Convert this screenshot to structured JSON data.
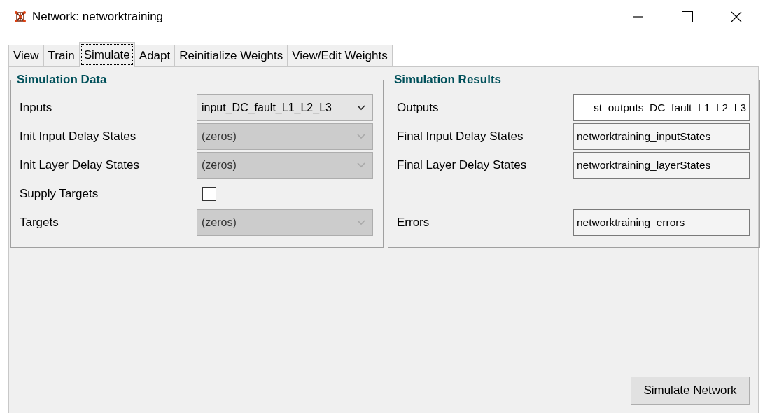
{
  "window": {
    "title": "Network: networktraining"
  },
  "tabs": [
    {
      "label": "View",
      "selected": false
    },
    {
      "label": "Train",
      "selected": false
    },
    {
      "label": "Simulate",
      "selected": true
    },
    {
      "label": "Adapt",
      "selected": false
    },
    {
      "label": "Reinitialize Weights",
      "selected": false
    },
    {
      "label": "View/Edit Weights",
      "selected": false
    }
  ],
  "simulation_data": {
    "title": "Simulation Data",
    "rows": [
      {
        "label": "Inputs",
        "kind": "dropdown",
        "value": "input_DC_fault_L1_L2_L3",
        "disabled": false
      },
      {
        "label": "Init Input Delay States",
        "kind": "dropdown",
        "value": "(zeros)",
        "disabled": true
      },
      {
        "label": "Init Layer Delay States",
        "kind": "dropdown",
        "value": "(zeros)",
        "disabled": true
      },
      {
        "label": "Supply Targets",
        "kind": "checkbox",
        "checked": false
      },
      {
        "label": "Targets",
        "kind": "dropdown",
        "value": "(zeros)",
        "disabled": true
      }
    ]
  },
  "simulation_results": {
    "title": "Simulation Results",
    "rows": [
      {
        "label": "Outputs",
        "kind": "field",
        "value": "st_outputs_DC_fault_L1_L2_L3",
        "disabled": false
      },
      {
        "label": "Final Input Delay States",
        "kind": "field",
        "value": "networktraining_inputStates",
        "disabled": true
      },
      {
        "label": "Final Layer Delay States",
        "kind": "field",
        "value": "networktraining_layerStates",
        "disabled": true
      },
      {
        "kind": "spacer"
      },
      {
        "label": "Errors",
        "kind": "field",
        "value": "networktraining_errors",
        "disabled": true
      }
    ]
  },
  "buttons": [
    "Simulate Network"
  ]
}
